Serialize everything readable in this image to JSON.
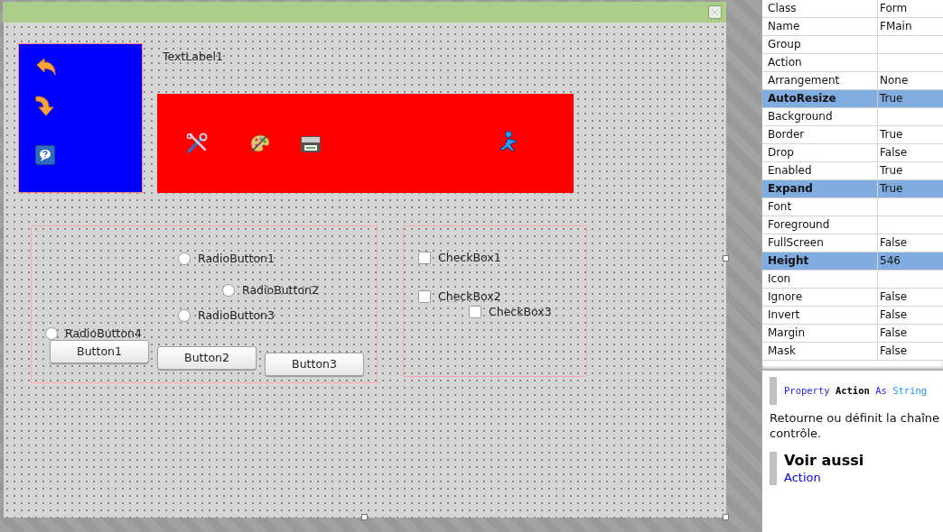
{
  "form": {
    "text_label": "TextLabel1",
    "radio_buttons": [
      {
        "label": "RadioButton1",
        "selected": false
      },
      {
        "label": "RadioButton2",
        "selected": false
      },
      {
        "label": "RadioButton3",
        "selected": false
      },
      {
        "label": "RadioButton4",
        "selected": false
      }
    ],
    "buttons": [
      "Button1",
      "Button2",
      "Button3"
    ],
    "check_boxes": [
      {
        "label": "CheckBox1",
        "checked": false
      },
      {
        "label": "CheckBox2",
        "checked": false
      },
      {
        "label": "CheckBox3",
        "checked": false
      }
    ]
  },
  "properties": [
    {
      "name": "Class",
      "value": "Form",
      "selected": false
    },
    {
      "name": "Name",
      "value": "FMain",
      "selected": false
    },
    {
      "name": "Group",
      "selected": false
    },
    {
      "name": "Action",
      "selected": false
    },
    {
      "name": "Arrangement",
      "value": "None",
      "selected": false
    },
    {
      "name": "AutoResize",
      "value": "True",
      "selected": true
    },
    {
      "name": "Background",
      "selected": false
    },
    {
      "name": "Border",
      "value": "True",
      "selected": false
    },
    {
      "name": "Drop",
      "value": "False",
      "selected": false
    },
    {
      "name": "Enabled",
      "value": "True",
      "selected": false
    },
    {
      "name": "Expand",
      "value": "True",
      "selected": true
    },
    {
      "name": "Font",
      "selected": false
    },
    {
      "name": "Foreground",
      "selected": false
    },
    {
      "name": "FullScreen",
      "value": "False",
      "selected": false
    },
    {
      "name": "Height",
      "value": "546",
      "selected": true
    },
    {
      "name": "Icon",
      "selected": false
    },
    {
      "name": "Ignore",
      "value": "False",
      "selected": false
    },
    {
      "name": "Invert",
      "value": "False",
      "selected": false
    },
    {
      "name": "Margin",
      "value": "False",
      "selected": false
    },
    {
      "name": "Mask",
      "value": "False",
      "selected": false
    }
  ],
  "help": {
    "signature": [
      {
        "kind": "keyword",
        "text": "Property"
      },
      {
        "kind": "name",
        "text": "Action"
      },
      {
        "kind": "keyword",
        "text": "As"
      },
      {
        "kind": "type",
        "text": "String"
      }
    ],
    "description_lines": [
      "Retourne ou définit la chaîne",
      "contrôle."
    ],
    "see_also_title": "Voir aussi",
    "see_also_links": [
      "Action"
    ]
  }
}
